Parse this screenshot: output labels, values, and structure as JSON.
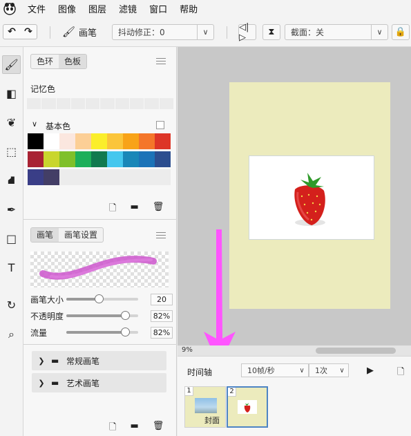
{
  "menu": [
    "文件",
    "图像",
    "图层",
    "滤镜",
    "窗口",
    "帮助"
  ],
  "toolbar": {
    "undo_icon": "undo-arrow",
    "redo_icon": "redo-arrow",
    "brush_label": "画笔",
    "stabilizer": "抖动修正：0",
    "clip": "截面：关"
  },
  "color_panel": {
    "tabs": [
      "色环",
      "色板"
    ],
    "active_tab": "色板",
    "memory_label": "记忆色",
    "basic_label": "基本色",
    "swatches": [
      "#000000",
      "#ffffff",
      "#fbe7df",
      "#fccf96",
      "#fbee2a",
      "#fbc53a",
      "#f8a318",
      "#f4762a",
      "#dd3527",
      "#a82233",
      "#c9d62e",
      "#7fc02a",
      "#1daf5a",
      "#117a4f",
      "#45c7ee",
      "#1a87b8",
      "#1c73b8",
      "#2c4e8f",
      "#3a3e87",
      "#433e66",
      "#ececec",
      "#ececec",
      "#ececec",
      "#ececec",
      "#ececec",
      "#ececec",
      "#ececec"
    ]
  },
  "brush_panel": {
    "tabs": [
      "画笔",
      "画笔设置"
    ],
    "active_tab": "画笔",
    "size_label": "画笔大小",
    "size_value": "20",
    "size_level": 0.45,
    "opacity_label": "不透明度",
    "opacity_value": "82%",
    "opacity_level": 0.82,
    "flow_label": "流量",
    "flow_value": "82%",
    "flow_level": 0.82,
    "folders": [
      "常规画笔",
      "艺术画笔"
    ]
  },
  "canvas": {
    "zoom": "9%",
    "bg_color": "#ecebbd"
  },
  "timeline": {
    "title": "时间轴",
    "fps": "10帧/秒",
    "loop": "1次",
    "frames": [
      {
        "num": "1",
        "label": "封面"
      },
      {
        "num": "2",
        "label": ""
      }
    ]
  },
  "accent_color": "#ff55ff"
}
